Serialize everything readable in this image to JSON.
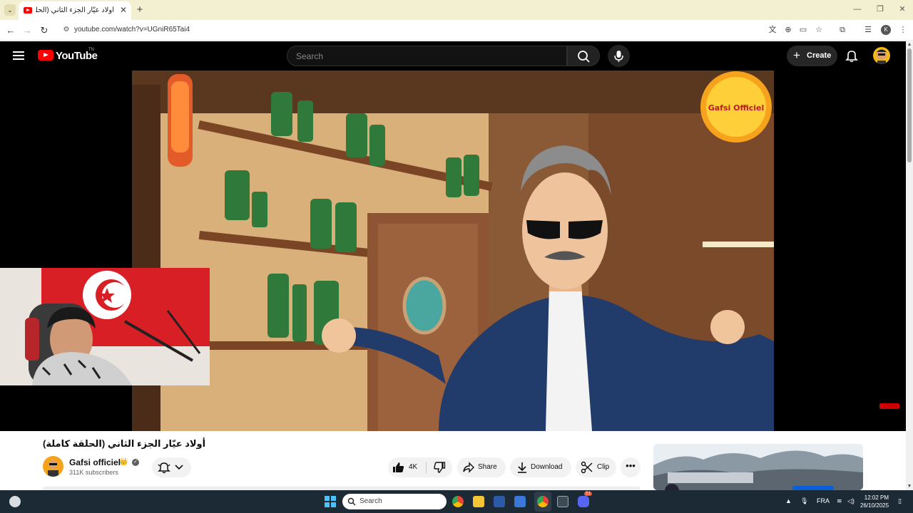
{
  "browser": {
    "tab_title": "أولاد عيّار الجزء الثاني (الحلقة",
    "url": "youtube.com/watch?v=UGniR65Tai4",
    "profile_initial": "K"
  },
  "youtube": {
    "logo_text": "YouTube",
    "logo_country": "TN",
    "search_placeholder": "Search",
    "create_label": "Create"
  },
  "video": {
    "title": "أولاد عيّار الجزء الثاني (الحلقة كاملة)",
    "watermark_text": "Gafsi Officiel"
  },
  "channel": {
    "name": "Gafsi officiel",
    "badge_emoji": "👑",
    "subscribers": "311K subscribers"
  },
  "actions": {
    "like_count": "4K",
    "share": "Share",
    "download": "Download",
    "clip": "Clip",
    "more": "•••"
  },
  "taskbar": {
    "search_label": "Search",
    "language": "FRA",
    "time": "12:02 PM",
    "date": "26/10/2025",
    "discord_badge": "51"
  },
  "colors": {
    "youtube_red": "#ff0000",
    "header_bg": "#000000",
    "tabstrip_bg": "#f3efd1",
    "taskbar_bg": "#1c2a36"
  }
}
